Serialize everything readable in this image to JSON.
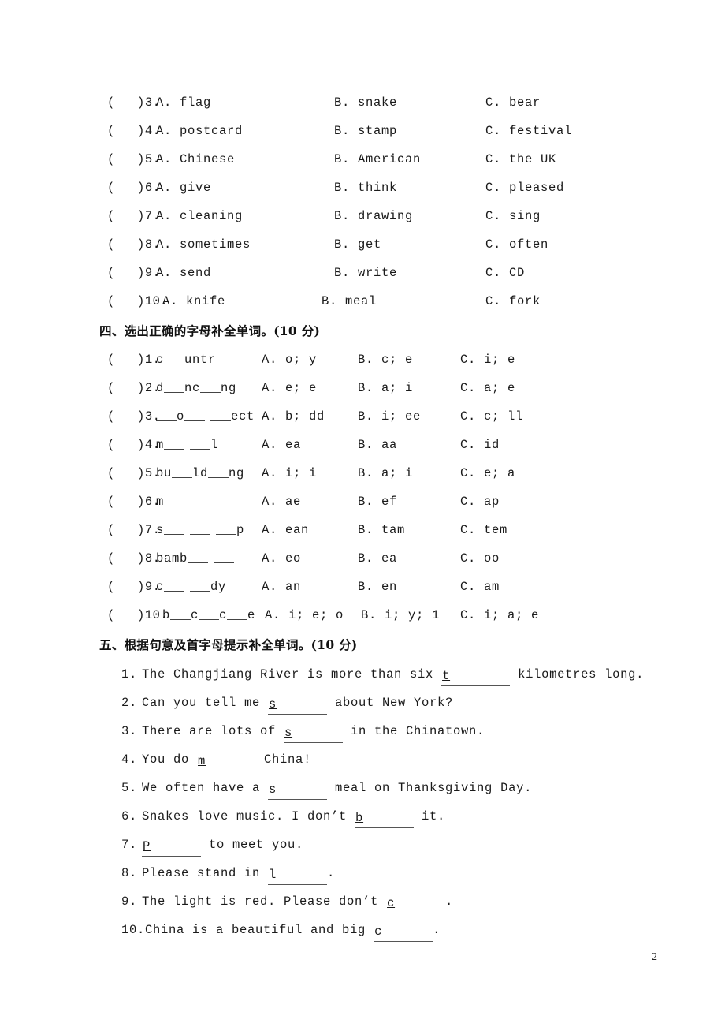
{
  "page": {
    "number": "2"
  },
  "section3": {
    "items": [
      {
        "num": "3.",
        "a": "A. flag",
        "b": "B. snake",
        "c": "C. bear"
      },
      {
        "num": "4.",
        "a": "A. postcard",
        "b": "B. stamp",
        "c": "C. festival"
      },
      {
        "num": "5.",
        "a": "A. Chinese",
        "b": "B. American",
        "c": "C. the UK"
      },
      {
        "num": "6.",
        "a": "A. give",
        "b": "B. think",
        "c": "C. pleased"
      },
      {
        "num": "7.",
        "a": "A. cleaning",
        "b": "B. drawing",
        "c": "C. sing"
      },
      {
        "num": "8.",
        "a": "A. sometimes",
        "b": "B. get",
        "c": "C. often"
      },
      {
        "num": "9.",
        "a": "A. send",
        "b": "B. write",
        "c": "C. CD"
      },
      {
        "num": "10.",
        "a": "A. knife",
        "b": "B. meal",
        "c": "C. fork"
      }
    ],
    "paren": "("
  },
  "section4": {
    "heading": "四、选出正确的字母补全单词。(10 分)",
    "paren": "(",
    "items": [
      {
        "num": "1.",
        "word": "c__untr__",
        "a": "A. o; y",
        "b": "B. c; e",
        "c": "C. i; e"
      },
      {
        "num": "2.",
        "word": "d__nc__ng",
        "a": "A. e; e",
        "b": "B. a; i",
        "c": "C. a; e"
      },
      {
        "num": "3.",
        "word": "__o__ __ect",
        "a": "A. b; dd",
        "b": "B. i; ee",
        "c": "C. c; ll"
      },
      {
        "num": "4.",
        "word": "m__ __l",
        "a": "A. ea",
        "b": "B. aa",
        "c": "C. id"
      },
      {
        "num": "5.",
        "word": "bu__ld__ng",
        "a": "A. i; i",
        "b": "B. a; i",
        "c": "C. e; a"
      },
      {
        "num": "6.",
        "word": "m__ __",
        "a": "A. ae",
        "b": "B. ef",
        "c": "C. ap"
      },
      {
        "num": "7.",
        "word": "s__ __ __p",
        "a": "A. ean",
        "b": "B. tam",
        "c": "C. tem"
      },
      {
        "num": "8.",
        "word": "bamb__ __",
        "a": "A. eo",
        "b": "B. ea",
        "c": "C. oo"
      },
      {
        "num": "9.",
        "word": "c__ __dy",
        "a": "A. an",
        "b": "B. en",
        "c": "C. am"
      },
      {
        "num": "10.",
        "word": "b__c__c__e",
        "a": "A. i; e; o",
        "b": "B. i; y; 1",
        "c": "C. i; a; e"
      }
    ]
  },
  "section5": {
    "heading": "五、根据句意及首字母提示补全单词。(10 分)",
    "items": [
      {
        "num": "1.",
        "pre": "The Changjiang River is more than six ",
        "seed": "t",
        "post": " kilometres long."
      },
      {
        "num": "2.",
        "pre": "Can you tell me ",
        "seed": "s",
        "post": " about New York?"
      },
      {
        "num": "3.",
        "pre": "There are lots of ",
        "seed": "s",
        "post": " in the Chinatown."
      },
      {
        "num": "4.",
        "pre": "You do ",
        "seed": "m",
        "post": " China!"
      },
      {
        "num": "5.",
        "pre": "We often have a ",
        "seed": "s",
        "post": " meal on Thanksgiving Day."
      },
      {
        "num": "6.",
        "pre": "Snakes love music. I don’t ",
        "seed": "b",
        "post": " it."
      },
      {
        "num": "7.",
        "pre": "",
        "seed": "P",
        "post": " to meet you."
      },
      {
        "num": "8.",
        "pre": "Please stand in ",
        "seed": "l",
        "post": "."
      },
      {
        "num": "9.",
        "pre": "The light is red. Please don’t ",
        "seed": "c",
        "post": "."
      },
      {
        "num": "10.",
        "pre": "China is a beautiful and big ",
        "seed": "c",
        "post": "."
      }
    ]
  }
}
